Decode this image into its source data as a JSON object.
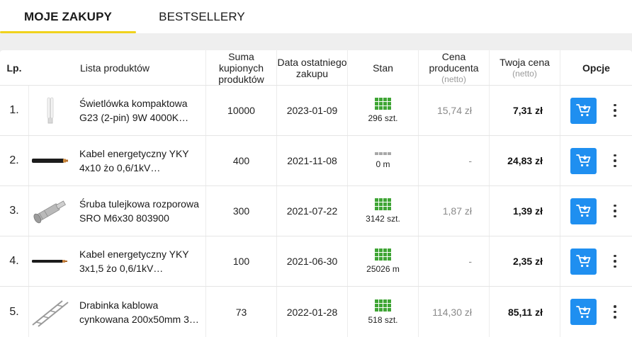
{
  "tabs": [
    {
      "label": "MOJE ZAKUPY"
    },
    {
      "label": "BESTSELLERY"
    }
  ],
  "table": {
    "headers": {
      "lp": "Lp.",
      "products": "Lista produktów",
      "sum": "Suma kupionych produktów",
      "date": "Data ostatniego zakupu",
      "stan": "Stan",
      "producer_price": "Cena producenta",
      "producer_price_note": "(netto)",
      "your_price": "Twoja cena",
      "your_price_note": "(netto)",
      "options": "Opcje"
    },
    "rows": [
      {
        "lp": "1.",
        "name": "Świetlówka kompaktowa G23 (2-pin) 9W 4000K…",
        "image": "fluorescent-bulb-image",
        "sum": "10000",
        "date": "2023-01-09",
        "stock_text": "296 szt.",
        "stock_level": "full",
        "producer_price": "15,74 zł",
        "your_price": "7,31 zł"
      },
      {
        "lp": "2.",
        "name": "Kabel energetyczny YKY 4x10 żo 0,6/1kV…",
        "image": "cable-image",
        "sum": "400",
        "date": "2021-11-08",
        "stock_text": "0 m",
        "stock_level": "empty",
        "producer_price": "-",
        "your_price": "24,83 zł"
      },
      {
        "lp": "3.",
        "name": "Śruba tulejkowa rozporowa SRO M6x30 803900",
        "image": "sleeve-anchor-image",
        "sum": "300",
        "date": "2021-07-22",
        "stock_text": "3142 szt.",
        "stock_level": "full",
        "producer_price": "1,87 zł",
        "your_price": "1,39 zł"
      },
      {
        "lp": "4.",
        "name": "Kabel energetyczny YKY 3x1,5 żo 0,6/1kV…",
        "image": "cable-image",
        "sum": "100",
        "date": "2021-06-30",
        "stock_text": "25026 m",
        "stock_level": "full",
        "producer_price": "-",
        "your_price": "2,35 zł"
      },
      {
        "lp": "5.",
        "name": "Drabinka kablowa cynkowana 200x50mm 3…",
        "image": "cable-ladder-image",
        "sum": "73",
        "date": "2022-01-28",
        "stock_text": "518 szt.",
        "stock_level": "full",
        "producer_price": "114,30 zł",
        "your_price": "85,11 zł"
      }
    ]
  },
  "colors": {
    "accent_tab_underline": "#f0d21d",
    "cart_button": "#1f8ff0",
    "stock_available": "#3fa535",
    "stock_empty": "#a8a8a8"
  }
}
